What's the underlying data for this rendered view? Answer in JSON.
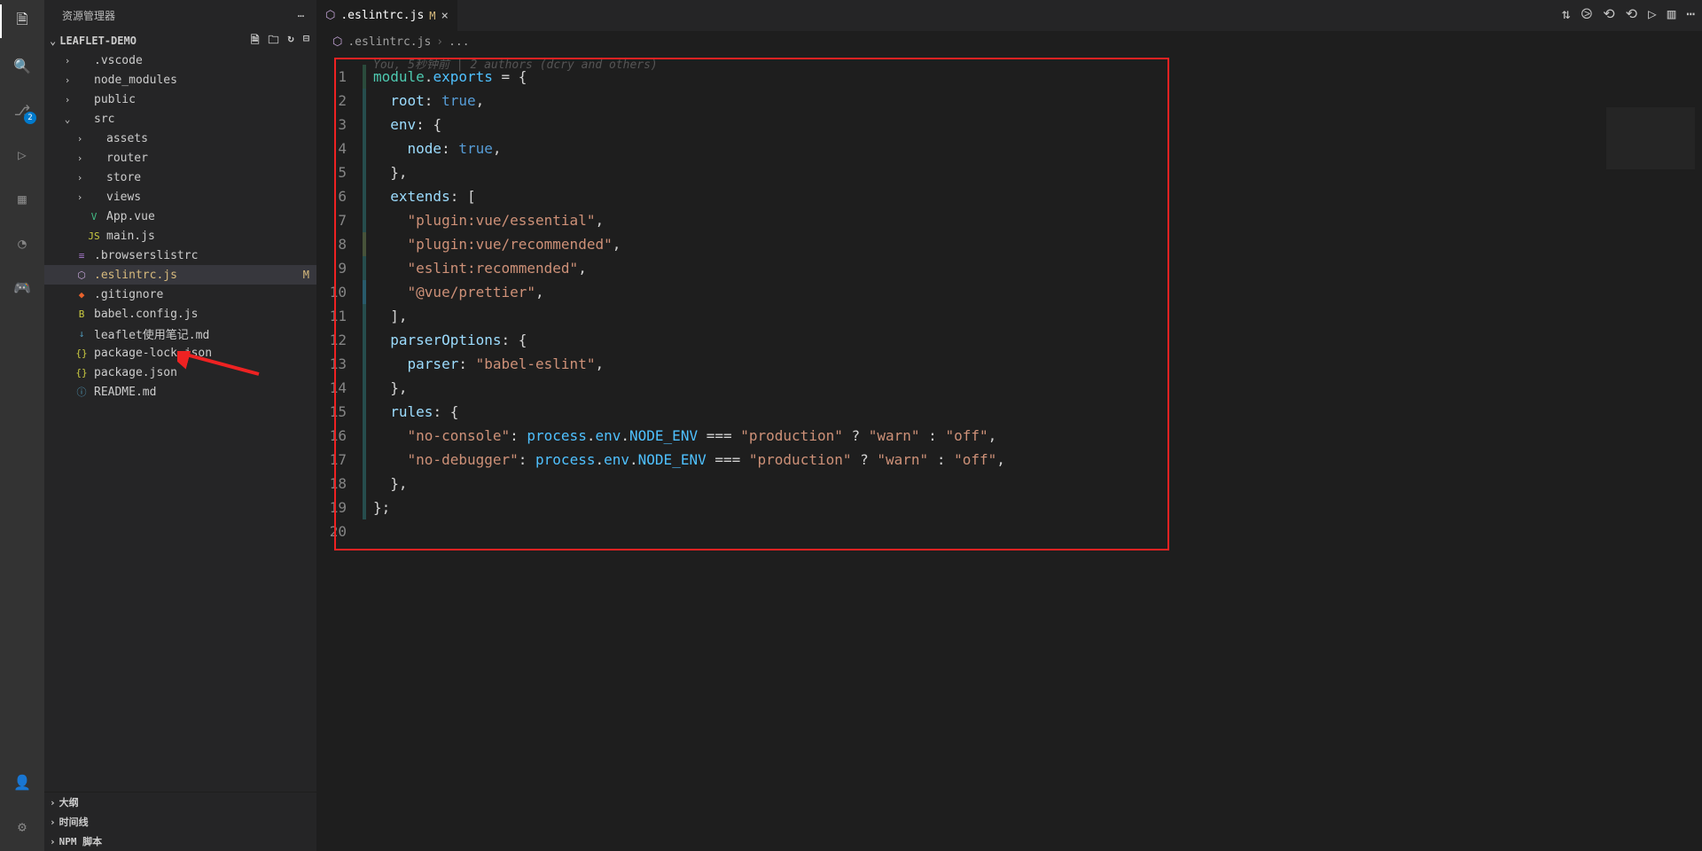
{
  "activitybar": {
    "items": [
      {
        "name": "explorer-icon",
        "active": true
      },
      {
        "name": "search-icon"
      },
      {
        "name": "source-control-icon",
        "badge": "2"
      },
      {
        "name": "run-debug-icon"
      },
      {
        "name": "extensions-icon"
      },
      {
        "name": "test-icon"
      },
      {
        "name": "game-icon"
      }
    ],
    "bottom": [
      {
        "name": "account-icon"
      },
      {
        "name": "gear-icon"
      }
    ]
  },
  "sidebar": {
    "title": "资源管理器",
    "project": "LEAFLET-DEMO",
    "tree": [
      {
        "indent": 1,
        "type": "dir",
        "open": false,
        "label": ".vscode",
        "icon": "›"
      },
      {
        "indent": 1,
        "type": "dir",
        "open": false,
        "label": "node_modules",
        "icon": "›"
      },
      {
        "indent": 1,
        "type": "dir",
        "open": false,
        "label": "public",
        "icon": "›"
      },
      {
        "indent": 1,
        "type": "dir",
        "open": true,
        "label": "src",
        "icon": "⌄"
      },
      {
        "indent": 2,
        "type": "dir",
        "open": false,
        "label": "assets",
        "icon": "›"
      },
      {
        "indent": 2,
        "type": "dir",
        "open": false,
        "label": "router",
        "icon": "›"
      },
      {
        "indent": 2,
        "type": "dir",
        "open": false,
        "label": "store",
        "icon": "›"
      },
      {
        "indent": 2,
        "type": "dir",
        "open": false,
        "label": "views",
        "icon": "›"
      },
      {
        "indent": 2,
        "type": "file",
        "label": "App.vue",
        "ficon": "V",
        "fcolor": "#41b883"
      },
      {
        "indent": 2,
        "type": "file",
        "label": "main.js",
        "ficon": "JS",
        "fcolor": "#cbcb41"
      },
      {
        "indent": 1,
        "type": "file",
        "label": ".browserslistrc",
        "ficon": "≡",
        "fcolor": "#a074c4"
      },
      {
        "indent": 1,
        "type": "file",
        "label": ".eslintrc.js",
        "ficon": "⬡",
        "fcolor": "#c4a5d8",
        "selected": true,
        "modified": true,
        "status": "M"
      },
      {
        "indent": 1,
        "type": "file",
        "label": ".gitignore",
        "ficon": "◆",
        "fcolor": "#e8622c"
      },
      {
        "indent": 1,
        "type": "file",
        "label": "babel.config.js",
        "ficon": "B",
        "fcolor": "#cbcb41"
      },
      {
        "indent": 1,
        "type": "file",
        "label": "leaflet使用笔记.md",
        "ficon": "↓",
        "fcolor": "#519aba"
      },
      {
        "indent": 1,
        "type": "file",
        "label": "package-lock.json",
        "ficon": "{}",
        "fcolor": "#cbcb41"
      },
      {
        "indent": 1,
        "type": "file",
        "label": "package.json",
        "ficon": "{}",
        "fcolor": "#cbcb41"
      },
      {
        "indent": 1,
        "type": "file",
        "label": "README.md",
        "ficon": "ⓘ",
        "fcolor": "#519aba"
      }
    ],
    "sections": [
      {
        "label": "大纲"
      },
      {
        "label": "时间线"
      },
      {
        "label": "NPM 脚本"
      }
    ]
  },
  "tabs": [
    {
      "label": ".eslintrc.js",
      "modified": true,
      "icon": "⬡",
      "iconColor": "#c4a5d8"
    }
  ],
  "breadcrumb": {
    "file": ".eslintrc.js",
    "sep": "›",
    "rest": "..."
  },
  "gitlens": "You, 5秒钟前 | 2 authors (dcry and others)",
  "code": {
    "lines": [
      [
        {
          "t": "module",
          "c": "k-mod"
        },
        {
          "t": ".",
          "c": "k-pun"
        },
        {
          "t": "exports",
          "c": "k-var"
        },
        {
          "t": " = {",
          "c": "k-pun"
        }
      ],
      [
        {
          "t": "  ",
          "c": ""
        },
        {
          "t": "root",
          "c": "k-key"
        },
        {
          "t": ": ",
          "c": "k-pun"
        },
        {
          "t": "true",
          "c": "k-const"
        },
        {
          "t": ",",
          "c": "k-pun"
        }
      ],
      [
        {
          "t": "  ",
          "c": ""
        },
        {
          "t": "env",
          "c": "k-key"
        },
        {
          "t": ": {",
          "c": "k-pun"
        }
      ],
      [
        {
          "t": "    ",
          "c": ""
        },
        {
          "t": "node",
          "c": "k-key"
        },
        {
          "t": ": ",
          "c": "k-pun"
        },
        {
          "t": "true",
          "c": "k-const"
        },
        {
          "t": ",",
          "c": "k-pun"
        }
      ],
      [
        {
          "t": "  },",
          "c": "k-pun"
        }
      ],
      [
        {
          "t": "  ",
          "c": ""
        },
        {
          "t": "extends",
          "c": "k-key"
        },
        {
          "t": ": [",
          "c": "k-pun"
        }
      ],
      [
        {
          "t": "    ",
          "c": ""
        },
        {
          "t": "\"plugin:vue/essential\"",
          "c": "k-str"
        },
        {
          "t": ",",
          "c": "k-pun"
        }
      ],
      [
        {
          "t": "    ",
          "c": ""
        },
        {
          "t": "\"plugin:vue/recommended\"",
          "c": "k-str"
        },
        {
          "t": ",",
          "c": "k-pun"
        }
      ],
      [
        {
          "t": "    ",
          "c": ""
        },
        {
          "t": "\"eslint:recommended\"",
          "c": "k-str"
        },
        {
          "t": ",",
          "c": "k-pun"
        }
      ],
      [
        {
          "t": "    ",
          "c": ""
        },
        {
          "t": "\"@vue/prettier\"",
          "c": "k-str"
        },
        {
          "t": ",",
          "c": "k-pun"
        }
      ],
      [
        {
          "t": "  ],",
          "c": "k-pun"
        }
      ],
      [
        {
          "t": "  ",
          "c": ""
        },
        {
          "t": "parserOptions",
          "c": "k-key"
        },
        {
          "t": ": {",
          "c": "k-pun"
        }
      ],
      [
        {
          "t": "    ",
          "c": ""
        },
        {
          "t": "parser",
          "c": "k-key"
        },
        {
          "t": ": ",
          "c": "k-pun"
        },
        {
          "t": "\"babel-eslint\"",
          "c": "k-str"
        },
        {
          "t": ",",
          "c": "k-pun"
        }
      ],
      [
        {
          "t": "  },",
          "c": "k-pun"
        }
      ],
      [
        {
          "t": "  ",
          "c": ""
        },
        {
          "t": "rules",
          "c": "k-key"
        },
        {
          "t": ": {",
          "c": "k-pun"
        }
      ],
      [
        {
          "t": "    ",
          "c": ""
        },
        {
          "t": "\"no-console\"",
          "c": "k-str"
        },
        {
          "t": ": ",
          "c": "k-pun"
        },
        {
          "t": "process",
          "c": "k-var"
        },
        {
          "t": ".",
          "c": "k-pun"
        },
        {
          "t": "env",
          "c": "k-var"
        },
        {
          "t": ".",
          "c": "k-pun"
        },
        {
          "t": "NODE_ENV",
          "c": "k-var"
        },
        {
          "t": " === ",
          "c": "k-pun"
        },
        {
          "t": "\"production\"",
          "c": "k-str"
        },
        {
          "t": " ? ",
          "c": "k-pun"
        },
        {
          "t": "\"warn\"",
          "c": "k-str"
        },
        {
          "t": " : ",
          "c": "k-pun"
        },
        {
          "t": "\"off\"",
          "c": "k-str"
        },
        {
          "t": ",",
          "c": "k-pun"
        }
      ],
      [
        {
          "t": "    ",
          "c": ""
        },
        {
          "t": "\"no-debugger\"",
          "c": "k-str"
        },
        {
          "t": ": ",
          "c": "k-pun"
        },
        {
          "t": "process",
          "c": "k-var"
        },
        {
          "t": ".",
          "c": "k-pun"
        },
        {
          "t": "env",
          "c": "k-var"
        },
        {
          "t": ".",
          "c": "k-pun"
        },
        {
          "t": "NODE_ENV",
          "c": "k-var"
        },
        {
          "t": " === ",
          "c": "k-pun"
        },
        {
          "t": "\"production\"",
          "c": "k-str"
        },
        {
          "t": " ? ",
          "c": "k-pun"
        },
        {
          "t": "\"warn\"",
          "c": "k-str"
        },
        {
          "t": " : ",
          "c": "k-pun"
        },
        {
          "t": "\"off\"",
          "c": "k-str"
        },
        {
          "t": ",",
          "c": "k-pun"
        }
      ],
      [
        {
          "t": "  },",
          "c": "k-pun"
        }
      ],
      [
        {
          "t": "};",
          "c": "k-pun"
        }
      ],
      [
        {
          "t": "",
          "c": ""
        }
      ]
    ],
    "blame": [
      "c1",
      "c2",
      "c2",
      "c2",
      "c2",
      "c2",
      "c2",
      "c3",
      "c2",
      "c4",
      "c2",
      "c2",
      "c2",
      "c2",
      "c2",
      "c2",
      "c2",
      "c2",
      "c2",
      ""
    ]
  },
  "titlebarIcons": [
    "git-compare-icon",
    "run-icon",
    "sync-icon",
    "sync-icon",
    "run-all-icon",
    "split-icon",
    "more-icon"
  ]
}
